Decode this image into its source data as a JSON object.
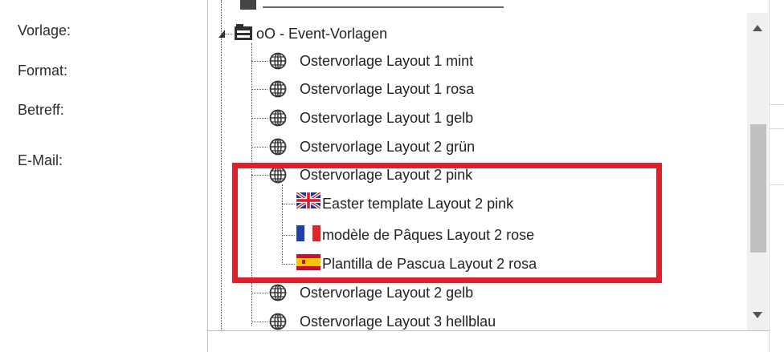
{
  "form": {
    "labels": {
      "vorlage": "Vorlage:",
      "format": "Format:",
      "betreff": "Betreff:",
      "email": "E-Mail:"
    }
  },
  "tree": {
    "folder": {
      "label": "oO - Event-Vorlagen",
      "icon": "folder-icon",
      "expanded": true
    },
    "items": [
      {
        "label": "Ostervorlage Layout 1 mint",
        "icon": "globe-icon"
      },
      {
        "label": "Ostervorlage Layout 1 rosa",
        "icon": "globe-icon"
      },
      {
        "label": "Ostervorlage Layout 1 gelb",
        "icon": "globe-icon"
      },
      {
        "label": "Ostervorlage Layout 2 grün",
        "icon": "globe-icon"
      },
      {
        "label": "Ostervorlage Layout 2 pink",
        "icon": "globe-icon"
      },
      {
        "label": "Easter template Layout 2 pink",
        "icon": "uk-flag-icon"
      },
      {
        "label": "modèle de Pâques Layout 2 rose",
        "icon": "france-flag-icon"
      },
      {
        "label": "Plantilla de Pascua Layout 2 rosa",
        "icon": "spain-flag-icon"
      },
      {
        "label": "Ostervorlage Layout 2 gelb",
        "icon": "globe-icon"
      },
      {
        "label": "Ostervorlage Layout 3 hellblau",
        "icon": "globe-icon"
      }
    ]
  },
  "colors": {
    "highlight": "#e21e2a",
    "scroll_thumb": "#c1c1c1"
  }
}
